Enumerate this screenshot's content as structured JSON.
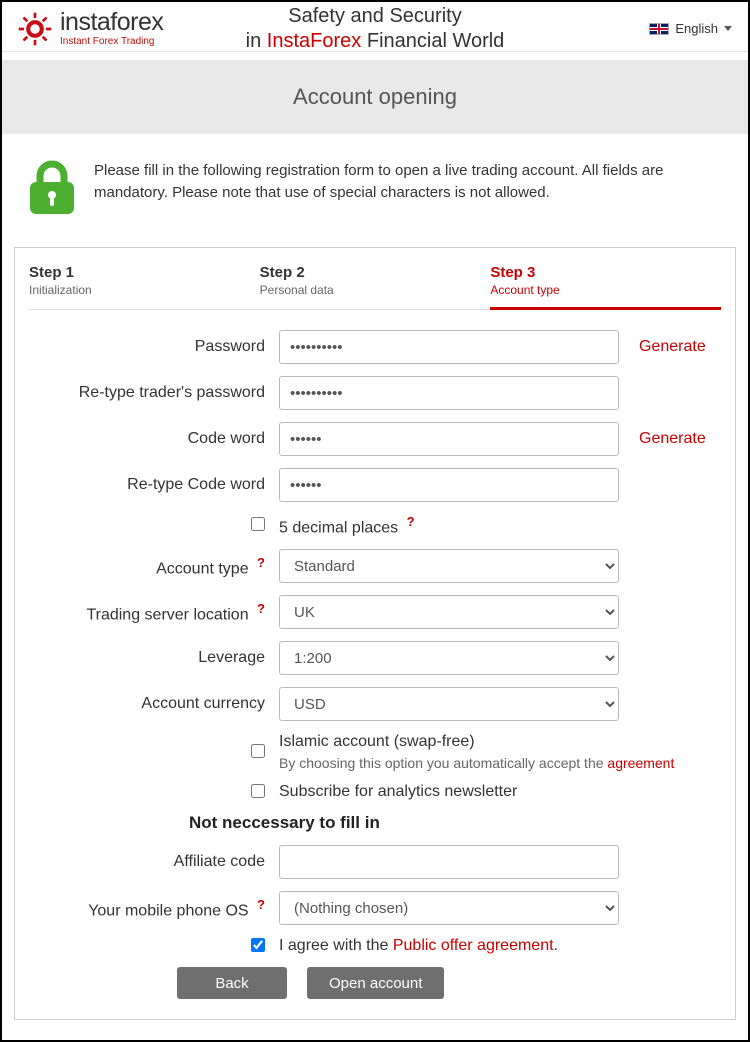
{
  "header": {
    "brand": "instaforex",
    "slogan": "Instant Forex Trading",
    "headline_pre": "Safety and Security",
    "headline_in": "in ",
    "headline_brand": "InstaForex",
    "headline_post": " Financial World",
    "language": "English"
  },
  "titlebar": "Account opening",
  "intro": "Please fill in the following registration form to open a live trading account. All fields are mandatory. Please note that use of special characters is not allowed.",
  "steps": [
    {
      "title": "Step 1",
      "sub": "Initialization"
    },
    {
      "title": "Step 2",
      "sub": "Personal data"
    },
    {
      "title": "Step 3",
      "sub": "Account type"
    }
  ],
  "form": {
    "password": {
      "label": "Password",
      "value": "••••••••••",
      "aux": "Generate"
    },
    "password2": {
      "label": "Re-type trader's password",
      "value": "••••••••••"
    },
    "codeword": {
      "label": "Code word",
      "value": "••••••",
      "aux": "Generate"
    },
    "codeword2": {
      "label": "Re-type Code word",
      "value": "••••••"
    },
    "decimal5": {
      "label": "5 decimal places"
    },
    "account_type": {
      "label": "Account type",
      "value": "Standard"
    },
    "server": {
      "label": "Trading server location",
      "value": "UK"
    },
    "leverage": {
      "label": "Leverage",
      "value": "1:200"
    },
    "currency": {
      "label": "Account currency",
      "value": "USD"
    },
    "islamic": {
      "label": "Islamic account (swap-free)",
      "note_pre": "By choosing this option you automatically accept the ",
      "note_link": "agreement"
    },
    "newsletter": {
      "label": "Subscribe for analytics newsletter"
    },
    "optional_head": "Not neccessary to fill in",
    "affiliate": {
      "label": "Affiliate code",
      "value": ""
    },
    "mobile_os": {
      "label": "Your mobile phone OS",
      "value": "(Nothing chosen)"
    },
    "agree": {
      "pre": "I agree with the ",
      "link": "Public offer agreement",
      "post": "."
    },
    "buttons": {
      "back": "Back",
      "submit": "Open account"
    }
  }
}
